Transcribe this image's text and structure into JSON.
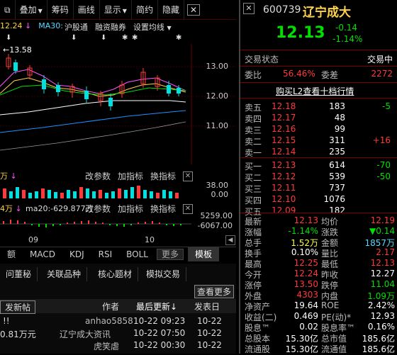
{
  "toolbar": {
    "items": [
      "叠加",
      "筹码",
      "画线",
      "显示",
      "简约",
      "隐藏"
    ],
    "first_icon": "copy-icon",
    "close": "✕"
  },
  "chart_info": {
    "price_label": "12.24",
    "ma30_label": "MA30:",
    "tags": [
      "沪股通",
      "融资融券",
      "设置均线"
    ],
    "high_mark": "13.58"
  },
  "axis": {
    "price_ticks": [
      "13.00",
      "12.00",
      "11.00"
    ],
    "vol_ticks": [
      "38.00",
      "0.00"
    ],
    "macd_ticks": [
      "5259.00",
      "-6067.00"
    ],
    "dates": [
      "09",
      "10"
    ]
  },
  "vol_panel": {
    "prefix": "万",
    "buttons": [
      "改参数",
      "加指标",
      "换指标"
    ]
  },
  "macd_panel": {
    "prefix": "4万",
    "ma20": "ma20:-629.877万",
    "buttons": [
      "改参数",
      "加指标",
      "换指标"
    ]
  },
  "indicator_tabs": [
    "额",
    "MACD",
    "KDJ",
    "RSI",
    "BOLL",
    "更多",
    "模板"
  ],
  "bottom": {
    "tabs": [
      "问董秘",
      "关联品种",
      "核心题材",
      "模拟交易"
    ],
    "more_btn": "查看更多",
    "post_btn": "发新帖",
    "headers": {
      "author": "作者",
      "updated": "最后更新↓",
      "posted": "发表日"
    },
    "rows": [
      {
        "left": "!!",
        "author": "anhao5858",
        "updated": "10-22 09:23",
        "posted": "10-22"
      },
      {
        "left": "0.81万元",
        "author": "辽宁成大资讯",
        "updated": "10-22 07:50",
        "posted": "10-22"
      },
      {
        "left": "",
        "author": "虎笑虐",
        "updated": "10-22 00:30",
        "posted": "10-22"
      }
    ]
  },
  "quote": {
    "code": "600739",
    "name": "辽宁成大",
    "price": "12.13",
    "change": "-0.14",
    "change_pct": "-1.14%",
    "status_label": "交易状态",
    "status_value": "交易中",
    "weibi_label": "委比",
    "weibi_value": "56.46%",
    "weicha_label": "委差",
    "weicha_value": "2272",
    "l2_link": "购买L2查看十档行情",
    "asks": [
      {
        "label": "卖五",
        "price": "12.18",
        "vol": "183",
        "chg": "-5"
      },
      {
        "label": "卖四",
        "price": "12.17",
        "vol": "48",
        "chg": ""
      },
      {
        "label": "卖三",
        "price": "12.16",
        "vol": "99",
        "chg": ""
      },
      {
        "label": "卖二",
        "price": "12.15",
        "vol": "311",
        "chg": "+16"
      },
      {
        "label": "卖一",
        "price": "12.14",
        "vol": "235",
        "chg": ""
      }
    ],
    "bids": [
      {
        "label": "买一",
        "price": "12.13",
        "vol": "614",
        "chg": "-70"
      },
      {
        "label": "买二",
        "price": "12.12",
        "vol": "539",
        "chg": "-50"
      },
      {
        "label": "买三",
        "price": "12.11",
        "vol": "737",
        "chg": ""
      },
      {
        "label": "买四",
        "price": "12.10",
        "vol": "1076",
        "chg": ""
      },
      {
        "label": "买五",
        "price": "12.09",
        "vol": "182",
        "chg": ""
      }
    ],
    "stats": [
      {
        "l1": "最新",
        "v1": "12.13",
        "c1": "red",
        "l2": "均价",
        "v2": "12.19",
        "c2": "red"
      },
      {
        "l1": "涨幅",
        "v1": "-1.14%",
        "c1": "grn",
        "l2": "涨跌",
        "v2": "▼0.14",
        "c2": "grn"
      },
      {
        "l1": "总手",
        "v1": "1.52万",
        "c1": "yel",
        "l2": "金额",
        "v2": "1857万",
        "c2": "cyan"
      },
      {
        "l1": "换手",
        "v1": "0.10%",
        "c1": "wht",
        "l2": "量比",
        "v2": "2.17",
        "c2": "red"
      },
      {
        "l1": "最高",
        "v1": "12.25",
        "c1": "red",
        "l2": "最低",
        "v2": "12.13",
        "c2": "red"
      },
      {
        "l1": "今开",
        "v1": "12.24",
        "c1": "red",
        "l2": "昨收",
        "v2": "12.27",
        "c2": "wht"
      },
      {
        "l1": "涨停",
        "v1": "13.50",
        "c1": "red",
        "l2": "跌停",
        "v2": "11.04",
        "c2": "grn"
      },
      {
        "l1": "外盘",
        "v1": "4303",
        "c1": "red",
        "l2": "内盘",
        "v2": "1.09万",
        "c2": "grn"
      },
      {
        "l1": "净资产",
        "v1": "19.64",
        "c1": "wht",
        "l2": "ROE",
        "v2": "2.42%",
        "c2": "wht"
      },
      {
        "l1": "收益(二)",
        "v1": "0.469",
        "c1": "wht",
        "l2": "PE(动)*",
        "v2": "12.93",
        "c2": "wht"
      },
      {
        "l1": "股息™",
        "v1": "0.02",
        "c1": "wht",
        "l2": "股息率™",
        "v2": "0.16%",
        "c2": "wht"
      },
      {
        "l1": "总股本",
        "v1": "15.30亿",
        "c1": "wht",
        "l2": "总市值",
        "v2": "185.6亿",
        "c2": "wht"
      },
      {
        "l1": "流通股",
        "v1": "15.30亿",
        "c1": "wht",
        "l2": "流通值",
        "v2": "185.6亿",
        "c2": "wht"
      }
    ]
  }
}
